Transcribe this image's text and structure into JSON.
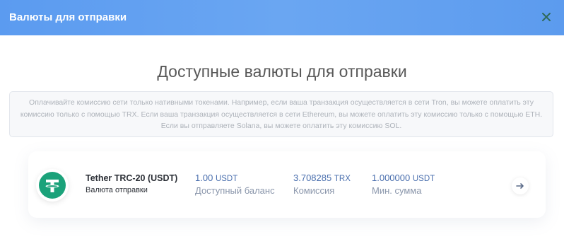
{
  "header": {
    "title": "Валюты для отправки"
  },
  "page_title": "Доступные валюты для отправки",
  "notice": "Оплачивайте комиссию сети только нативными токенами. Например, если ваша транзакция осуществляется в сети Tron, вы можете оплатить эту комиссию только с помощью TRX. Если ваша транзакция осуществляется в сети Ethereum, вы можете оплатить эту комиссию только с помощью ETH. Если вы отправляете Solana, вы можете оплатить эту комиссию SOL.",
  "currency": {
    "name": "Tether TRC-20 (USDT)",
    "subtitle": "Валюта отправки",
    "icon": "tether-icon",
    "icon_color": "#1ba27a",
    "balance": {
      "value": "1.00",
      "unit": "USDT",
      "label": "Доступный баланс"
    },
    "fee": {
      "value": "3.708285",
      "unit": "TRX",
      "label": "Комиссия"
    },
    "min_amount": {
      "value": "1.000000",
      "unit": "USDT",
      "label": "Мин. сумма"
    }
  },
  "colors": {
    "header_bg": "#5b9bf0",
    "value_text": "#4a6fae",
    "label_text": "#8a96ab"
  }
}
